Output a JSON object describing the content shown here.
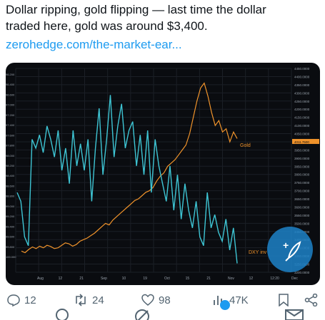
{
  "tweet": {
    "line1": "Dollar ripping, gold flipping — last time the dollar",
    "line2": "traded here, gold was around $3,400.",
    "link": "zerohedge.com/the-market-ear..."
  },
  "chart_data": {
    "type": "line",
    "title": "",
    "xlabel": "",
    "ylabel": "",
    "x_ticks": [
      "Aug",
      "12",
      "21",
      "Sep",
      "10",
      "19",
      "Oct",
      "15",
      "21",
      "Nov",
      "12",
      "12:20",
      "Dec"
    ],
    "y_right_ticks": [
      "4450.0000",
      "4400.0000",
      "4350.0000",
      "4300.0000",
      "4250.0000",
      "4200.0000",
      "4150.0000",
      "4100.0000",
      "4050.0000",
      "4011.7500",
      "3950.0000",
      "3900.0000",
      "3850.0000",
      "3800.0000",
      "3750.0000",
      "3700.0000",
      "3650.0000",
      "3600.0000",
      "3550.0000",
      "3500.0000",
      "3450.0000",
      "3400.0000",
      "3350.0000",
      "3300.0000",
      "3250.0000",
      "3200.0000"
    ],
    "y_left_ticks": [
      "96.200",
      "96.400",
      "96.600",
      "97.000",
      "97.200",
      "97.400",
      "97.600",
      "97.800",
      "98.000",
      "98.200",
      "98.400",
      "98.600",
      "98.800",
      "99.000",
      "99.200",
      "99.400",
      "99.600",
      "99.800",
      "100.000"
    ],
    "last_gold_value": "4011.7500",
    "series": [
      {
        "name": "Gold",
        "color": "#f0932b",
        "values": [
          3330,
          3320,
          3340,
          3355,
          3345,
          3360,
          3350,
          3365,
          3358,
          3345,
          3350,
          3365,
          3380,
          3375,
          3360,
          3370,
          3390,
          3400,
          3410,
          3425,
          3440,
          3460,
          3480,
          3500,
          3490,
          3520,
          3540,
          3560,
          3580,
          3600,
          3620,
          3640,
          3650,
          3670,
          3690,
          3700,
          3720,
          3760,
          3790,
          3810,
          3850,
          3870,
          3890,
          3920,
          3950,
          3980,
          4050,
          4150,
          4250,
          4330,
          4360,
          4280,
          4180,
          4100,
          4130,
          4060,
          4080,
          4000,
          4060,
          4020
        ]
      },
      {
        "name": "DXY inv",
        "color": "#3ec5d4",
        "values": [
          97.4,
          97.2,
          96.4,
          96.2,
          98.6,
          98.4,
          98.7,
          98.3,
          98.9,
          98.6,
          98.2,
          98.8,
          97.9,
          98.4,
          97.6,
          98.8,
          98.0,
          98.5,
          97.9,
          98.6,
          97.2,
          98.4,
          99.3,
          97.8,
          98.6,
          99.6,
          98.2,
          98.9,
          99.4,
          98.4,
          98.8,
          99.0,
          98.0,
          98.7,
          97.8,
          98.8,
          97.4,
          98.6,
          98.0,
          97.6,
          97.2,
          98.0,
          97.0,
          97.8,
          96.8,
          97.6,
          97.0,
          96.6,
          97.2,
          96.4,
          96.2,
          97.4,
          96.6,
          96.9,
          96.5,
          96.3,
          96.8,
          96.1,
          96.6,
          95.8
        ]
      }
    ]
  },
  "actions": {
    "reply_count": "12",
    "repost_count": "24",
    "like_count": "98",
    "views_count": "47K"
  },
  "colors": {
    "accent": "#1d9bf0",
    "gold": "#f0932b",
    "dxy": "#3ec5d4",
    "chart_bg": "#0a0c10"
  }
}
